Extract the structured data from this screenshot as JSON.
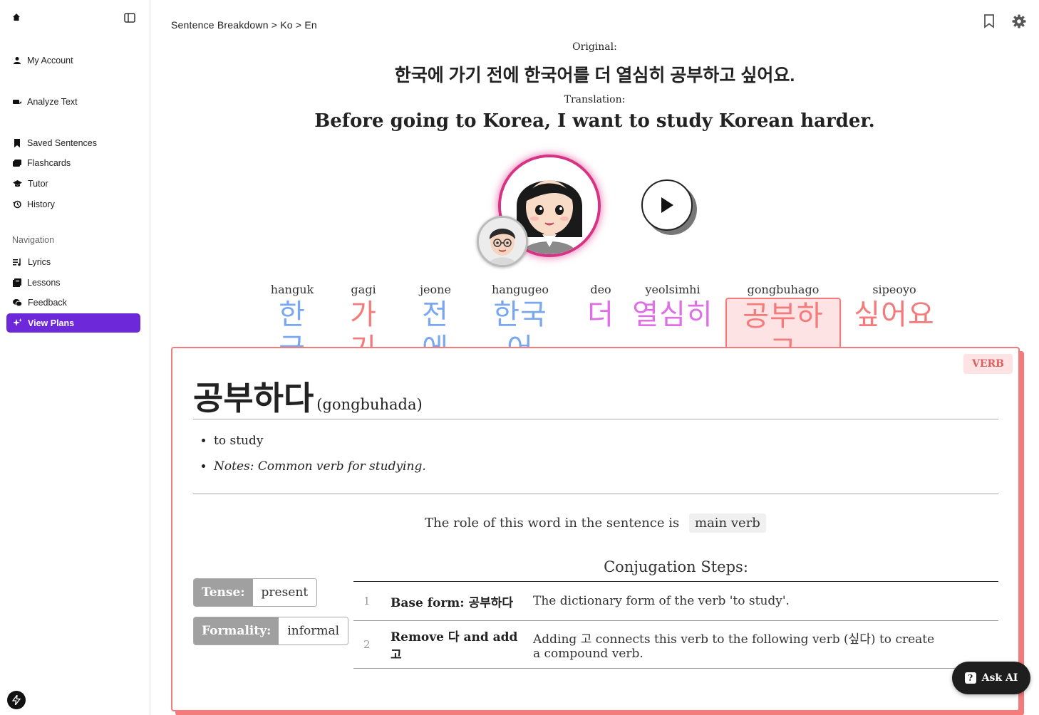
{
  "sidebar": {
    "items": [
      {
        "label": "My Account",
        "icon": "user-icon"
      },
      {
        "label": "Analyze Text",
        "icon": "analyze-icon"
      },
      {
        "label": "Saved Sentences",
        "icon": "bookmark-icon"
      },
      {
        "label": "Flashcards",
        "icon": "cards-icon"
      },
      {
        "label": "Tutor",
        "icon": "graduation-cap-icon"
      },
      {
        "label": "History",
        "icon": "history-icon"
      }
    ],
    "nav_heading": "Navigation",
    "nav_items": [
      {
        "label": "Lyrics",
        "icon": "music-list-icon"
      },
      {
        "label": "Lessons",
        "icon": "book-icon"
      },
      {
        "label": "Feedback",
        "icon": "comments-icon"
      },
      {
        "label": "View Plans",
        "icon": "sparkle-icon",
        "active": true
      }
    ]
  },
  "header": {
    "breadcrumb": "Sentence Breakdown > Ko > En"
  },
  "sentence": {
    "original_label": "Original:",
    "original": "한국에 가기 전에 한국어를 더 열심히 공부하고 싶어요.",
    "translation_label": "Translation:",
    "translation": "Before going to Korea, I want to study Korean harder."
  },
  "words": [
    {
      "rom": "hanguk",
      "kor": "한국",
      "color": "#7aa7f2"
    },
    {
      "rom": "gagi",
      "kor": "가기",
      "color": "#f47b7b"
    },
    {
      "rom": "jeone",
      "kor": "전에",
      "color": "#7aa7f2"
    },
    {
      "rom": "hangugeo",
      "kor": "한국어",
      "color": "#7aa7f2"
    },
    {
      "rom": "deo",
      "kor": "더",
      "color": "#e06ee6"
    },
    {
      "rom": "yeolsimhi",
      "kor": "열심히",
      "color": "#e06ee6"
    },
    {
      "rom": "gongbuhago",
      "kor": "공부하고",
      "color": "#f47b7b"
    },
    {
      "rom": "sipeoyo",
      "kor": "싶어요",
      "color": "#f47b7b"
    }
  ],
  "detail": {
    "pos": "VERB",
    "lemma": "공부하다",
    "lemma_rom": "(gongbuhada)",
    "definition": "to study",
    "notes": "Notes: Common verb for studying.",
    "role_prefix": "The role of this word in the sentence is",
    "role": "main verb",
    "tense_label": "Tense:",
    "tense": "present",
    "formality_label": "Formality:",
    "formality": "informal",
    "conj_title": "Conjugation Steps:",
    "steps": [
      {
        "n": "1",
        "step": "Base form: 공부하다",
        "desc": "The dictionary form of the verb 'to study'."
      },
      {
        "n": "2",
        "step": "Remove 다 and add 고",
        "desc": "Adding 고 connects this verb to the following verb (싶다) to create a compound verb."
      }
    ]
  },
  "ask_ai": "Ask AI"
}
